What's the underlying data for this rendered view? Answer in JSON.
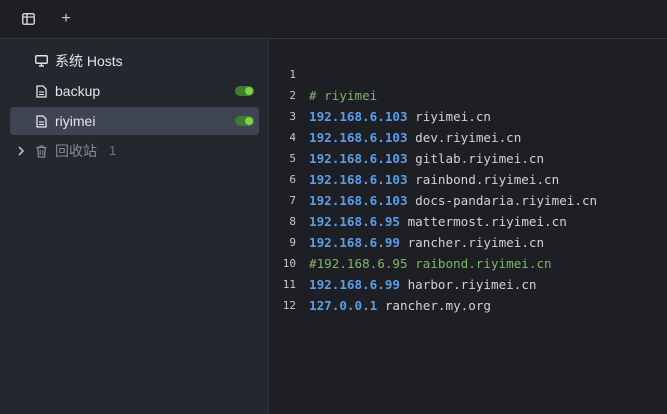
{
  "toolbar": {
    "sidebar_toggle_icon": "sidebar-panel-icon",
    "add_label": "+"
  },
  "sidebar": {
    "items": [
      {
        "label": "系统 Hosts",
        "icon": "monitor-icon",
        "active": false,
        "toggle": null
      },
      {
        "label": "backup",
        "icon": "document-icon",
        "active": false,
        "toggle": true
      },
      {
        "label": "riyimei",
        "icon": "document-icon",
        "active": true,
        "toggle": true
      }
    ],
    "trash": {
      "label": "回收站",
      "count": "1",
      "icon": "trash-icon"
    }
  },
  "editor": {
    "lines": [
      {
        "num": "1",
        "comment": "# riyimei"
      },
      {
        "num": "2",
        "ip": "192.168.6.103",
        "host": " riyimei.cn"
      },
      {
        "num": "3",
        "ip": "192.168.6.103",
        "host": " dev.riyimei.cn"
      },
      {
        "num": "4",
        "ip": "192.168.6.103",
        "host": " gitlab.riyimei.cn"
      },
      {
        "num": "5",
        "ip": "192.168.6.103",
        "host": " rainbond.riyimei.cn"
      },
      {
        "num": "6",
        "ip": "192.168.6.103",
        "host": " docs-pandaria.riyimei.cn"
      },
      {
        "num": "7",
        "ip": "192.168.6.95",
        "host": " mattermost.riyimei.cn"
      },
      {
        "num": "8",
        "ip": "192.168.6.99",
        "host": " rancher.riyimei.cn"
      },
      {
        "num": "9",
        "comment": "#192.168.6.95 raibond.riyimei.cn"
      },
      {
        "num": "10",
        "ip": "192.168.6.99",
        "host": " harbor.riyimei.cn"
      },
      {
        "num": "11",
        "ip": "127.0.0.1",
        "host": " rancher.my.org"
      },
      {
        "num": "12"
      }
    ]
  },
  "colors": {
    "accent_ip": "#5a9ee8",
    "comment": "#7fb36a",
    "toggle_on": "#7fd14f",
    "active_bg": "#3e4452"
  }
}
